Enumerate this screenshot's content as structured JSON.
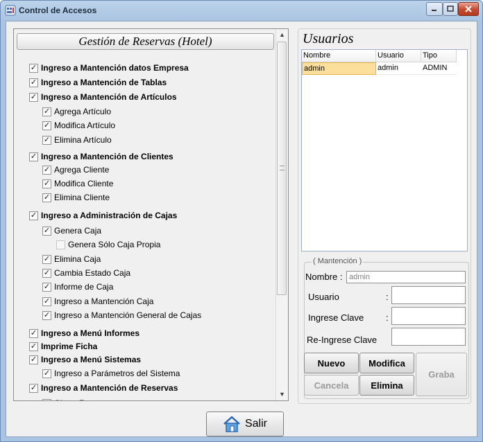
{
  "window": {
    "title": "Control de Accesos",
    "icon": "keyboard-app-icon",
    "controls": [
      "minimize-icon",
      "maximize-icon",
      "close-icon"
    ]
  },
  "permissions_panel": {
    "header": "Gestión de Reservas (Hotel)",
    "items": [
      {
        "label": "Ingreso a Mantención datos Empresa",
        "checked": true,
        "bold": true,
        "level": 0
      },
      {
        "label": "Ingreso a Mantención de Tablas",
        "checked": true,
        "bold": true,
        "level": 0
      },
      {
        "label": "Ingreso a Mantención de Artículos",
        "checked": true,
        "bold": true,
        "level": 0
      },
      {
        "label": "Agrega Artículo",
        "checked": true,
        "bold": false,
        "level": 1
      },
      {
        "label": "Modifica Artículo",
        "checked": true,
        "bold": false,
        "level": 1
      },
      {
        "label": "Elimina Artículo",
        "checked": true,
        "bold": false,
        "level": 1
      },
      {
        "label": "Ingreso a Mantención de Clientes",
        "checked": true,
        "bold": true,
        "level": 0
      },
      {
        "label": "Agrega Cliente",
        "checked": true,
        "bold": false,
        "level": 1
      },
      {
        "label": "Modifica Cliente",
        "checked": true,
        "bold": false,
        "level": 1
      },
      {
        "label": "Elimina Cliente",
        "checked": true,
        "bold": false,
        "level": 1
      },
      {
        "label": "Ingreso a Administración de Cajas",
        "checked": true,
        "bold": true,
        "level": 0
      },
      {
        "label": "Genera Caja",
        "checked": true,
        "bold": false,
        "level": 1
      },
      {
        "label": "Genera Sólo Caja Propia",
        "checked": false,
        "bold": false,
        "level": 2
      },
      {
        "label": "Elimina Caja",
        "checked": true,
        "bold": false,
        "level": 1
      },
      {
        "label": "Cambia Estado Caja",
        "checked": true,
        "bold": false,
        "level": 1
      },
      {
        "label": "Informe de Caja",
        "checked": true,
        "bold": false,
        "level": 1
      },
      {
        "label": "Ingreso a Mantención Caja",
        "checked": true,
        "bold": false,
        "level": 1
      },
      {
        "label": "Ingreso a Mantención General de Cajas",
        "checked": true,
        "bold": false,
        "level": 1
      },
      {
        "label": "Ingreso a  Menú Informes",
        "checked": true,
        "bold": true,
        "level": 0
      },
      {
        "label": "Imprime Ficha",
        "checked": true,
        "bold": true,
        "level": 0
      },
      {
        "label": "Ingreso a  Menú Sistemas",
        "checked": true,
        "bold": true,
        "level": 0
      },
      {
        "label": "Ingreso a Parámetros del Sistema",
        "checked": true,
        "bold": false,
        "level": 1
      },
      {
        "label": "Ingreso a  Mantención de Reservas",
        "checked": true,
        "bold": true,
        "level": 0
      },
      {
        "label": "Cierra Reserva",
        "checked": true,
        "bold": false,
        "level": 1
      }
    ]
  },
  "users_panel": {
    "title": "Usuarios",
    "columns": [
      "Nombre",
      "Usuario",
      "Tipo"
    ],
    "rows": [
      {
        "nombre": "admin",
        "usuario": "admin",
        "tipo": "ADMIN"
      }
    ]
  },
  "maintenance": {
    "legend": "( Mantención )",
    "nombre_label": "Nombre :",
    "nombre_value": "admin",
    "usuario_label": "Usuario",
    "clave_label": "Ingrese Clave",
    "reclave_label": "Re-Ingrese Clave",
    "colon": ":",
    "buttons": {
      "nuevo": "Nuevo",
      "modifica": "Modifica",
      "graba": "Graba",
      "cancela": "Cancela",
      "elimina": "Elimina"
    }
  },
  "footer": {
    "salir_label": "Salir",
    "salir_icon": "home-icon"
  }
}
